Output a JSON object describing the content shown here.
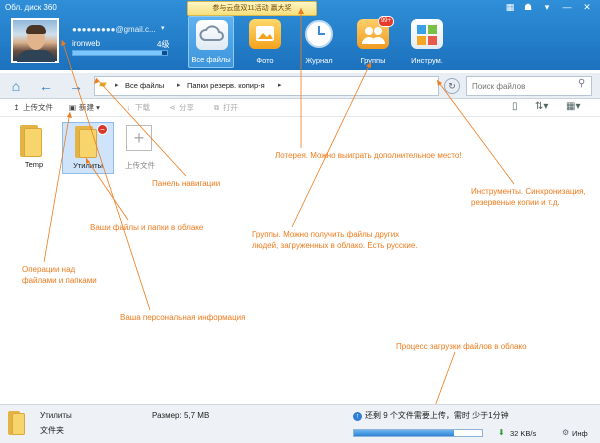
{
  "app": {
    "title": "Обл. диск 360",
    "promo": "参与云盘双11活动 赢大奖"
  },
  "window_controls": [
    "▦",
    "☗",
    "▾",
    "—",
    "✕"
  ],
  "user": {
    "email": "●●●●●●●●●@gmail.c...",
    "name": "ironweb",
    "level": "4级",
    "storage_fraction": 0.95
  },
  "nav_tabs": [
    {
      "label": "Все файлы",
      "icon": "cloud-icon",
      "active": true
    },
    {
      "label": "Фото",
      "icon": "photo-icon",
      "active": false
    },
    {
      "label": "Журнал",
      "icon": "clock-icon",
      "active": false
    },
    {
      "label": "Группы",
      "icon": "group-icon",
      "active": false,
      "badge": "99+"
    },
    {
      "label": "Инструм.",
      "icon": "tools-icon",
      "active": false
    }
  ],
  "address": {
    "crumbs": [
      "Все файлы",
      "Папки резерв. копир-я"
    ],
    "search_placeholder": "Поиск файлов"
  },
  "actions": [
    {
      "label": "上传文件",
      "icon": "↥",
      "enabled": true
    },
    {
      "label": "新建",
      "icon": "▣",
      "enabled": true
    },
    {
      "label": "下载",
      "icon": "↓",
      "enabled": false
    },
    {
      "label": "分享",
      "icon": "⋖",
      "enabled": false
    },
    {
      "label": "打开",
      "icon": "⧉",
      "enabled": false
    }
  ],
  "files": [
    {
      "label": "Temp",
      "kind": "folder",
      "selected": false
    },
    {
      "label": "Утилиты",
      "kind": "folder",
      "selected": true
    },
    {
      "label": "上传文件",
      "kind": "upload",
      "selected": false
    }
  ],
  "annotations": {
    "navigation_panel": "Панель навигации",
    "lottery": "Лотерея. Можно выиграть дополнительное место!",
    "tools": "Инструменты. Синхронизация,\nрезервеные копии и т.д.",
    "cloud_files": "Ваши файлы и папки в облаке",
    "groups": "Группы. Можно получить файлы других\nлюдей, загруженных в облако. Есть русские.",
    "operations": "Операции над\nфайлами и папками",
    "personal_info": "Ваша персональная информация",
    "upload_progress": "Процесс загрузки файлов в облако"
  },
  "status": {
    "name": "Утилиты",
    "type": "文件夹",
    "size": "Размер: 5,7 MB",
    "info": "还剩 9 个文件需要上传，需时 少于1分钟",
    "progress_fraction": 0.78,
    "speed": "32 KB/s",
    "more": "Инф"
  },
  "colors": {
    "header": "#1c71bd",
    "annotation": "#f07b1c",
    "active_tab": "#3d95dc"
  }
}
